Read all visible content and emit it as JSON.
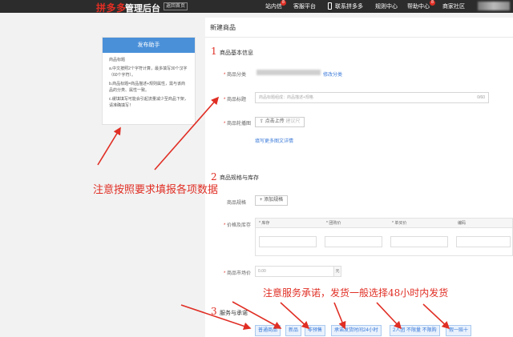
{
  "topbar": {
    "brand": "拼多多",
    "brand_sub": "管理后台",
    "back_home": "返回首页",
    "nav": {
      "messages": "站内信",
      "messages_badge": "8",
      "service": "客服平台",
      "contact": "联系拼多多",
      "rules": "规则中心",
      "help": "帮助中心",
      "help_badge": "8",
      "community": "商家社区"
    }
  },
  "helper": {
    "title": "发布助手",
    "heading": "商品标题",
    "tip_a": "a.中文按照2个字符计算，最多填写30个汉字（60个字符）。",
    "tip_b": "b.商品标题=商品描述+规则属性，需与该商品的分类、属性一致。",
    "tip_c": "c.缓填填写可能会引起流量减少至商品下架，请准确填写！"
  },
  "form": {
    "page_title": "新建商品",
    "section1": {
      "num": "1",
      "title": "商品基本信息"
    },
    "category_label": "商品分类",
    "category_edit": "修改分类",
    "title_label": "商品标题",
    "title_placeholder": "商品标题组成：商品描述+规格",
    "title_counter": "0/60",
    "carousel_label": "商品轮播图",
    "upload_button": "点击上传",
    "upload_hint": "建议尺",
    "more_guide": "填写更多图文详情",
    "section2": {
      "num": "2",
      "title": "商品规格与库存"
    },
    "spec_label": "商品规格",
    "add_spec": "添加规格",
    "price_stock_label": "价格及库存",
    "spec_columns": [
      "* 库存",
      "* 团购价",
      "* 单买价",
      "编码"
    ],
    "market_price_label": "商品市场价",
    "market_price_value": "0.00",
    "market_price_unit": "元",
    "section3": {
      "num": "3",
      "title": "服务与承诺"
    },
    "service_tags": [
      "普通商品",
      "新品",
      "非预售",
      "承诺发货时间24小时",
      "2人团 不限量 不限购",
      "假一赔十"
    ]
  },
  "annotations": {
    "note1": "注意按照要求填报各项数据",
    "note2": "注意服务承诺，发货一般选择48小时内发货"
  },
  "colors": {
    "accent_red": "#e02e24",
    "link_blue": "#3b7ad9",
    "helper_blue": "#4a90d9",
    "topbar": "#2c2c2c"
  }
}
